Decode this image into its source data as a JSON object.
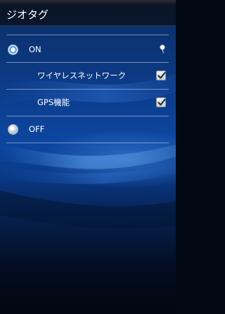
{
  "title_bar": {
    "title": "ジオタグ"
  },
  "geotag": {
    "on_option": {
      "label": "ON",
      "selected": true
    },
    "wireless_network": {
      "label": "ワイヤレスネットワーク",
      "checked": true
    },
    "gps": {
      "label": "GPS機能",
      "checked": true
    },
    "off_option": {
      "label": "OFF",
      "selected": false
    }
  },
  "icons": {
    "location": "location-pin-icon",
    "check": "checkmark-icon"
  },
  "colors": {
    "radio_selected": "#3d9ce8",
    "background_top": "#0b2c63",
    "background_bottom": "#02060f"
  }
}
